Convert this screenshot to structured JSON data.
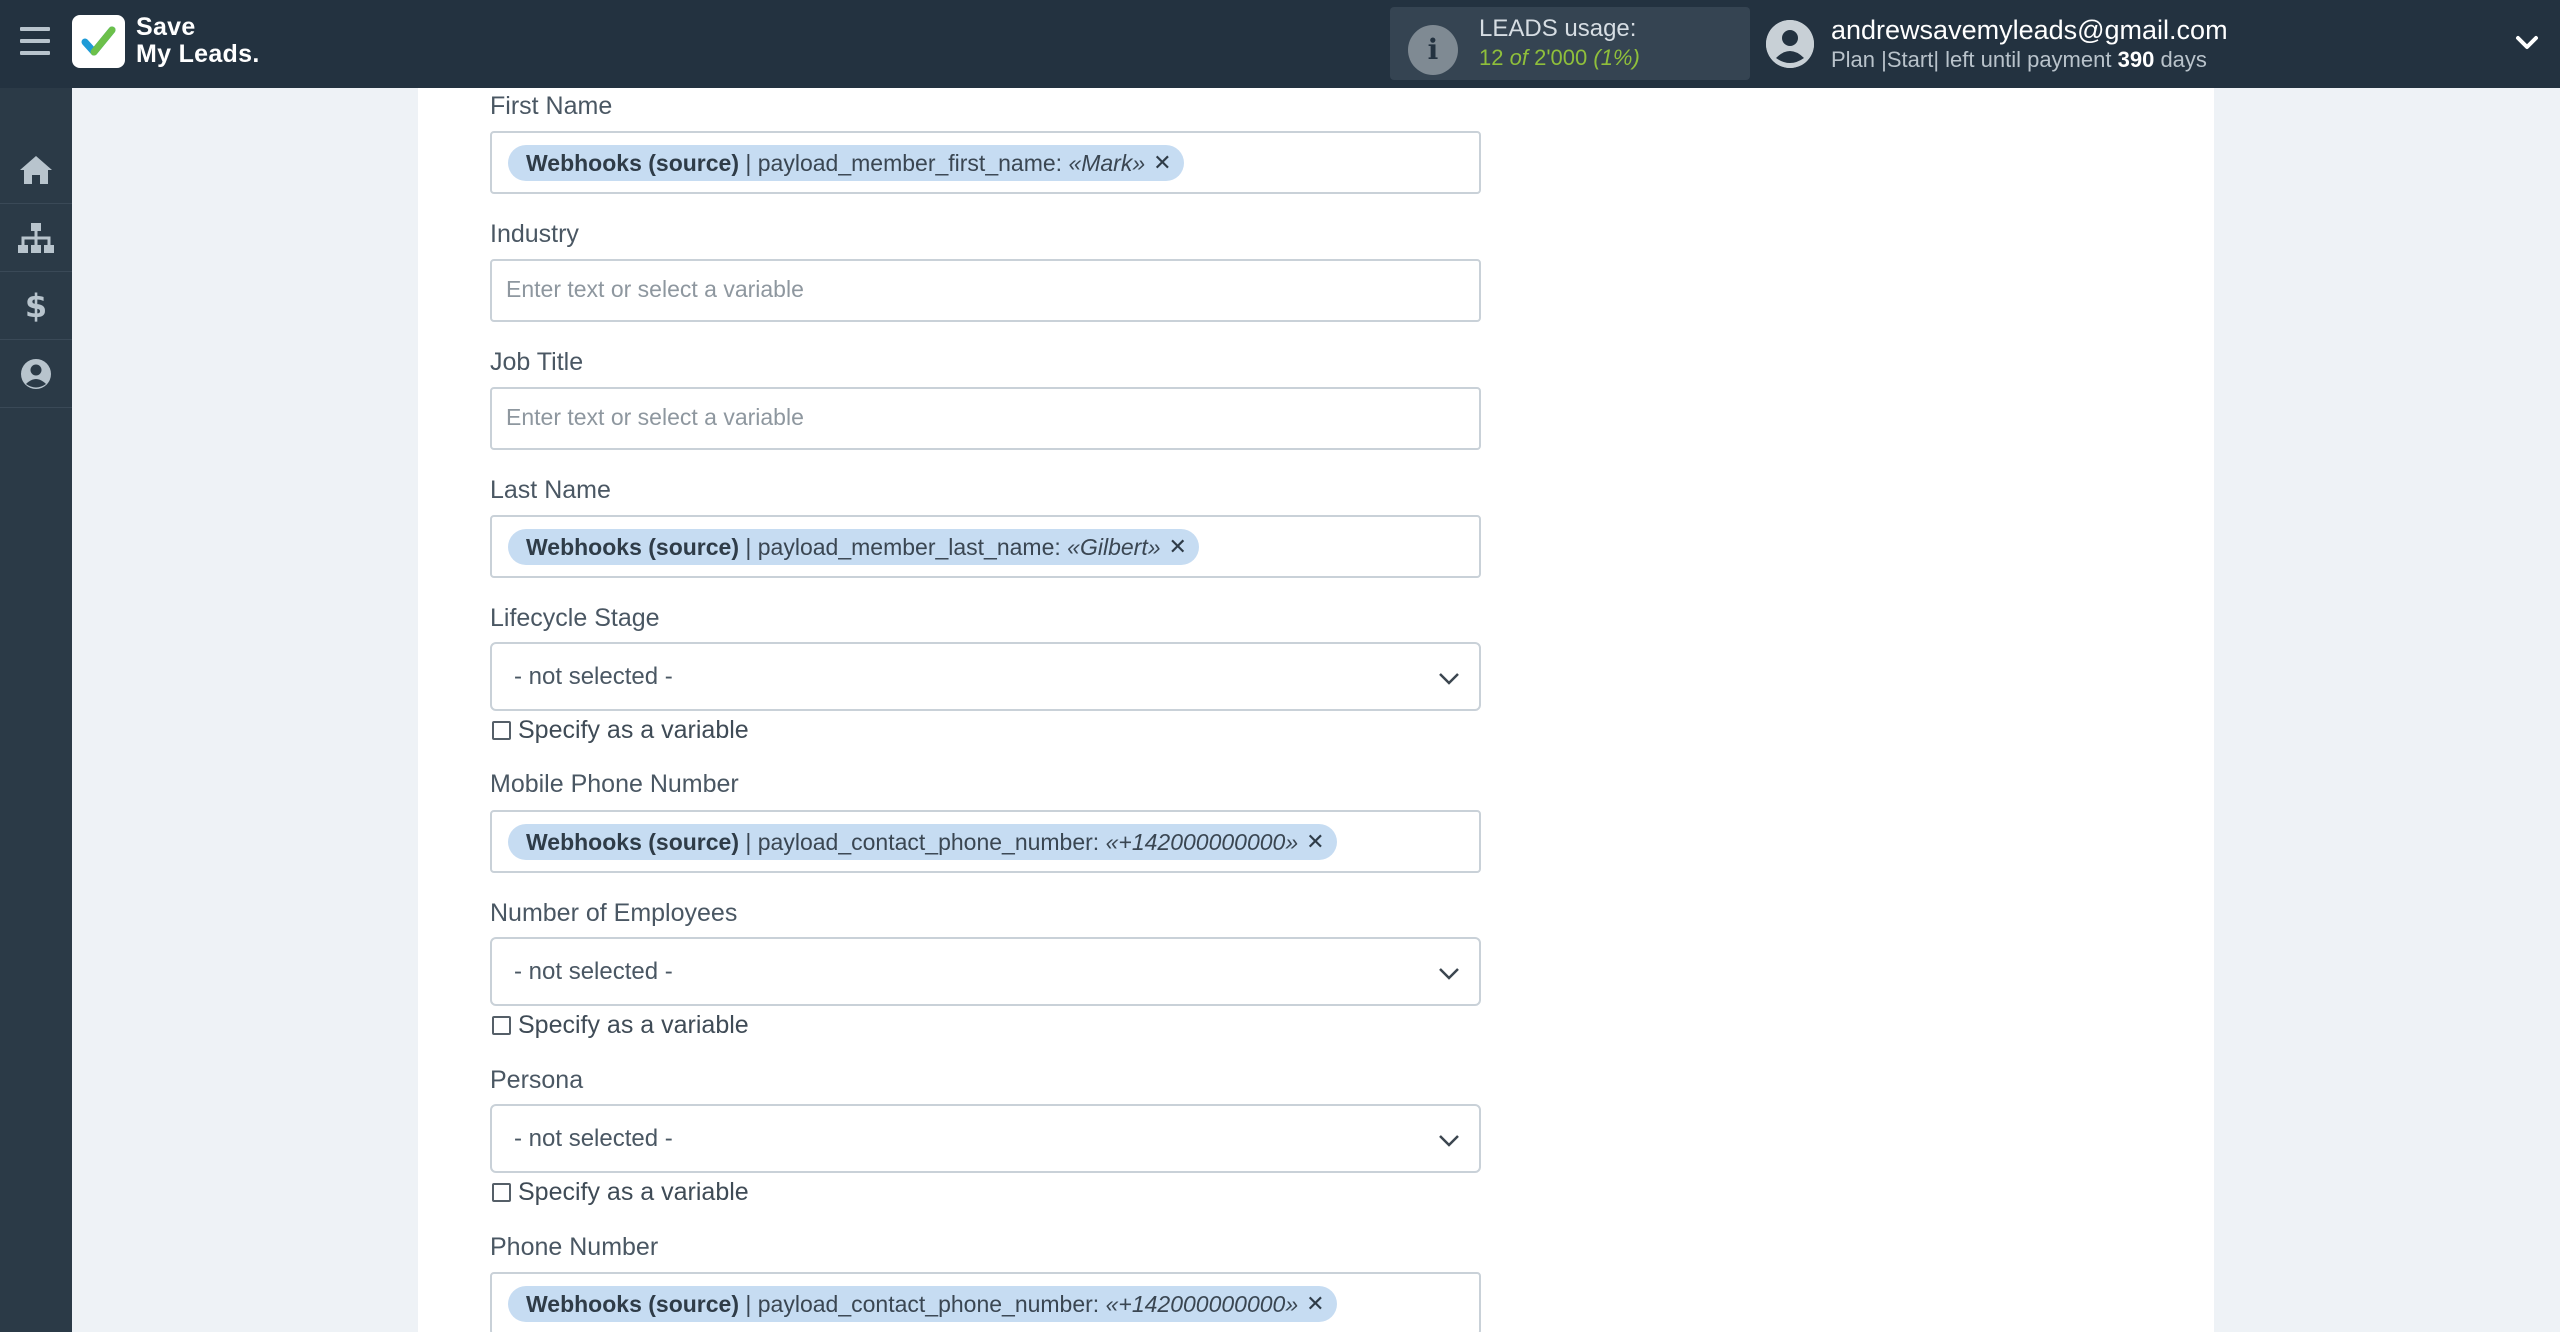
{
  "app": {
    "logo_line1": "Save",
    "logo_line2": "My Leads."
  },
  "leads": {
    "title": "LEADS usage:",
    "used": "12",
    "of": "of",
    "total": "2'000",
    "percent": "(1%)"
  },
  "user": {
    "email": "andrewsavemyleads@gmail.com",
    "plan_text": "Plan |Start| left until payment",
    "days_number": "390",
    "days_label": "days"
  },
  "sidebar": {
    "items": [
      {
        "icon": "home-icon"
      },
      {
        "icon": "sitemap-icon"
      },
      {
        "icon": "dollar-icon"
      },
      {
        "icon": "user-circle-icon"
      }
    ]
  },
  "form": {
    "first_name": {
      "label": "First Name",
      "tag_source": "Webhooks (source)",
      "tag_sep": "|",
      "tag_field": "payload_member_first_name:",
      "tag_value": "«Mark»"
    },
    "industry": {
      "label": "Industry",
      "placeholder": "Enter text or select a variable"
    },
    "job_title": {
      "label": "Job Title",
      "placeholder": "Enter text or select a variable"
    },
    "last_name": {
      "label": "Last Name",
      "tag_source": "Webhooks (source)",
      "tag_sep": "|",
      "tag_field": "payload_member_last_name:",
      "tag_value": "«Gilbert»"
    },
    "lifecycle_stage": {
      "label": "Lifecycle Stage",
      "value": "- not selected -",
      "checkbox_label": "Specify as a variable"
    },
    "mobile_phone": {
      "label": "Mobile Phone Number",
      "tag_source": "Webhooks (source)",
      "tag_sep": "|",
      "tag_field": "payload_contact_phone_number:",
      "tag_value": "«+142000000000»"
    },
    "employees": {
      "label": "Number of Employees",
      "value": "- not selected -",
      "checkbox_label": "Specify as a variable"
    },
    "persona": {
      "label": "Persona",
      "value": "- not selected -",
      "checkbox_label": "Specify as a variable"
    },
    "phone": {
      "label": "Phone Number",
      "tag_source": "Webhooks (source)",
      "tag_sep": "|",
      "tag_field": "payload_contact_phone_number:",
      "tag_value": "«+142000000000»"
    }
  },
  "colors": {
    "topbar": "#233240",
    "sidebar": "#2b3a47",
    "tag_bg": "#c6dcf2",
    "leads_accent": "#8fbf3b"
  }
}
